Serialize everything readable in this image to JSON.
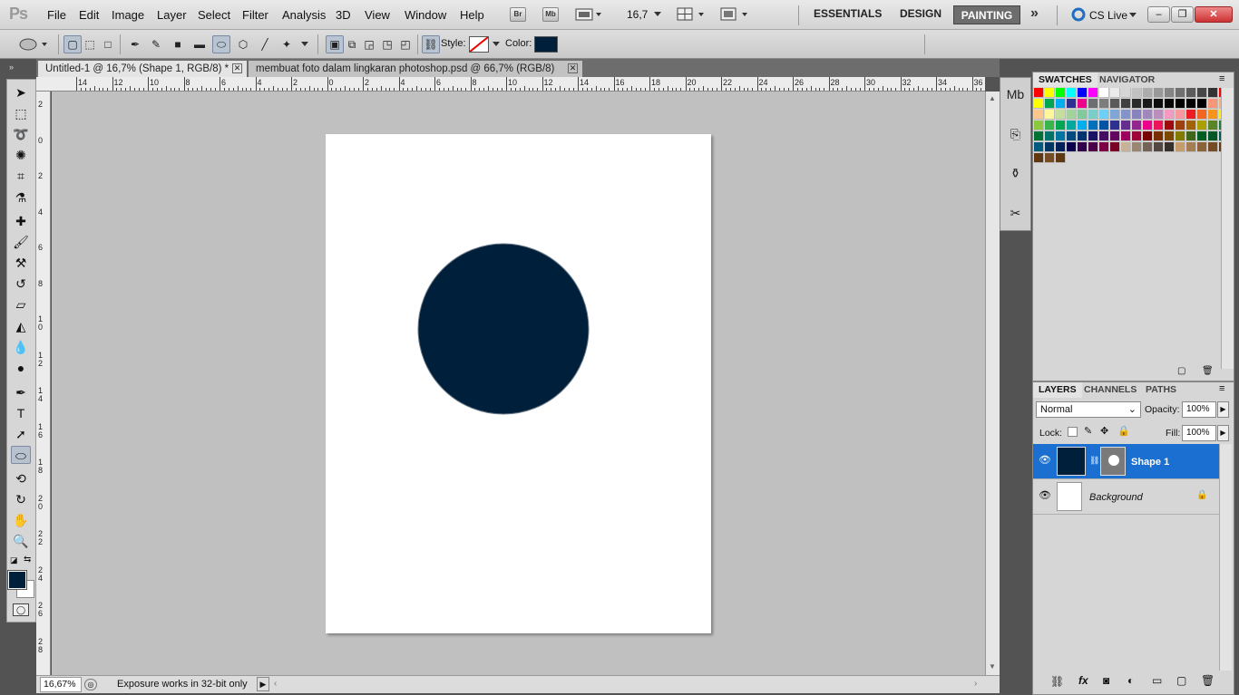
{
  "app": {
    "logo": "Ps"
  },
  "menu": [
    "File",
    "Edit",
    "Image",
    "Layer",
    "Select",
    "Filter",
    "Analysis",
    "3D",
    "View",
    "Window",
    "Help"
  ],
  "appbar": {
    "bridge": "Br",
    "minibridge": "Mb",
    "zoom": "16,7"
  },
  "workspaces": [
    "ESSENTIALS",
    "DESIGN",
    "PAINTING"
  ],
  "active_workspace": "PAINTING",
  "cs_live": "CS Live",
  "options": {
    "style_label": "Style:",
    "color_label": "Color:",
    "color_value": "#001f3a"
  },
  "tabs": [
    {
      "label": "Untitled-1 @ 16,7% (Shape 1, RGB/8) *",
      "active": true
    },
    {
      "label": "membuat foto dalam lingkaran photoshop.psd @ 66,7% (RGB/8)",
      "active": false
    }
  ],
  "ruler_h": [
    "14",
    "12",
    "10",
    "8",
    "6",
    "4",
    "2",
    "0",
    "2",
    "4",
    "6",
    "8",
    "10",
    "12",
    "14",
    "16",
    "18",
    "20",
    "22",
    "24",
    "26",
    "28",
    "30",
    "32",
    "34",
    "36"
  ],
  "ruler_v": [
    "2",
    "0",
    "2",
    "4",
    "6",
    "8",
    "1 0",
    "1 2",
    "1 4",
    "1 6",
    "1 8",
    "2 0",
    "2 2",
    "2 4",
    "2 6",
    "2 8"
  ],
  "canvas": {
    "shape_color": "#001f3a",
    "stroke_color": "#6a7a88"
  },
  "status": {
    "zoom": "16,67%",
    "message": "Exposure works in 32-bit only"
  },
  "panels": {
    "swatches_tabs": [
      "SWATCHES",
      "NAVIGATOR"
    ],
    "layers_tabs": [
      "LAYERS",
      "CHANNELS",
      "PATHS"
    ],
    "blend_mode": "Normal",
    "opacity_label": "Opacity:",
    "opacity_value": "100%",
    "lock_label": "Lock:",
    "fill_label": "Fill:",
    "fill_value": "100%",
    "layers": [
      {
        "name": "Shape 1",
        "selected": true
      },
      {
        "name": "Background",
        "selected": false
      }
    ]
  },
  "swatch_rows": [
    [
      "#ff0000",
      "#ffff00",
      "#00ff00",
      "#00ffff",
      "#0000ff",
      "#ff00ff",
      "#ffffff",
      "#ebebeb",
      "#d6d6d6",
      "#c2c2c2",
      "#adadad",
      "#999999",
      "#858585",
      "#707070",
      "#5c5c5c",
      "#474747",
      "#333333",
      "#ff0000"
    ],
    [
      "#ffff00",
      "#00a651",
      "#00aeef",
      "#2e3192",
      "#ec008c",
      "#6d6e71",
      "#7d7d7d",
      "#5a5a5a",
      "#404040",
      "#2b2b2b",
      "#1a1a1a",
      "#0d0d0d",
      "#050505",
      "#000000",
      "#000000",
      "#000000",
      "#f7977a",
      "#f9ad81"
    ],
    [
      "#fdc68a",
      "#fff79a",
      "#c4df9b",
      "#a3d39c",
      "#82ca9d",
      "#7bcdc8",
      "#6ecff6",
      "#7ea7d8",
      "#8493ca",
      "#8882be",
      "#a187be",
      "#bc8dbf",
      "#f49ac2",
      "#f6989d",
      "#ed1c24",
      "#f26522",
      "#f7941d",
      "#fff200"
    ],
    [
      "#8dc63f",
      "#39b54a",
      "#00a651",
      "#00a99d",
      "#00aeef",
      "#0072bc",
      "#0054a6",
      "#2e3192",
      "#662d91",
      "#92278f",
      "#ec008c",
      "#ed145b",
      "#9e0b0f",
      "#a0410d",
      "#a3620a",
      "#aba000",
      "#598527",
      "#1a7b30"
    ],
    [
      "#007236",
      "#00746b",
      "#0076a3",
      "#004b80",
      "#003471",
      "#1b1464",
      "#440e62",
      "#630460",
      "#9e005d",
      "#9e0039",
      "#790000",
      "#7b2e00",
      "#7d4900",
      "#827b00",
      "#406618",
      "#005e20",
      "#005826",
      "#005952"
    ],
    [
      "#005b7f",
      "#003663",
      "#002157",
      "#0d004c",
      "#32004b",
      "#4b0049",
      "#7b0046",
      "#7a0026",
      "#c7b299",
      "#998675",
      "#736357",
      "#534741",
      "#37302a",
      "#c69c6d",
      "#a67c52",
      "#8c6239",
      "#754c24",
      "#603913"
    ],
    [
      "#603913",
      "#754c24",
      "#603913"
    ]
  ]
}
